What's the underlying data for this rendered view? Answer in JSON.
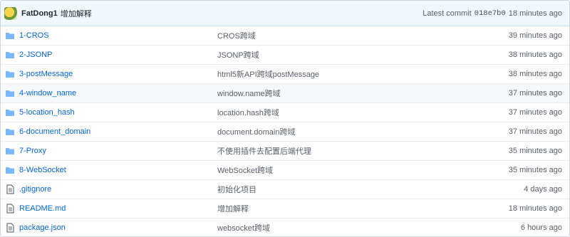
{
  "commit": {
    "author": "FatDong1",
    "message": "增加解释",
    "latest_label": "Latest commit",
    "sha": "018e7b0",
    "age": "18 minutes ago"
  },
  "rows": [
    {
      "type": "folder",
      "name": "1-CROS",
      "message": "CROS跨域",
      "age": "39 minutes ago"
    },
    {
      "type": "folder",
      "name": "2-JSONP",
      "message": "JSONP跨域",
      "age": "38 minutes ago"
    },
    {
      "type": "folder",
      "name": "3-postMessage",
      "message": "html5新API跨域postMessage",
      "age": "38 minutes ago"
    },
    {
      "type": "folder",
      "name": "4-window_name",
      "message": "window.name跨域",
      "age": "37 minutes ago"
    },
    {
      "type": "folder",
      "name": "5-location_hash",
      "message": "location.hash跨域",
      "age": "37 minutes ago"
    },
    {
      "type": "folder",
      "name": "6-document_domain",
      "message": "document.domain跨域",
      "age": "37 minutes ago"
    },
    {
      "type": "folder",
      "name": "7-Proxy",
      "message": "不使用插件去配置后端代理",
      "age": "35 minutes ago"
    },
    {
      "type": "folder",
      "name": "8-WebSocket",
      "message": "WebSocket跨域",
      "age": "35 minutes ago"
    },
    {
      "type": "file",
      "name": ".gitignore",
      "message": "初始化项目",
      "age": "4 days ago"
    },
    {
      "type": "file",
      "name": "README.md",
      "message": "增加解释",
      "age": "18 minutes ago"
    },
    {
      "type": "file",
      "name": "package.json",
      "message": "websocket跨域",
      "age": "6 hours ago"
    }
  ],
  "icons": {
    "folder": "folder-icon",
    "file": "file-icon"
  },
  "colors": {
    "link": "#0366d6",
    "folder": "#79b8ff",
    "commit_bar": "#f1f8ff"
  }
}
